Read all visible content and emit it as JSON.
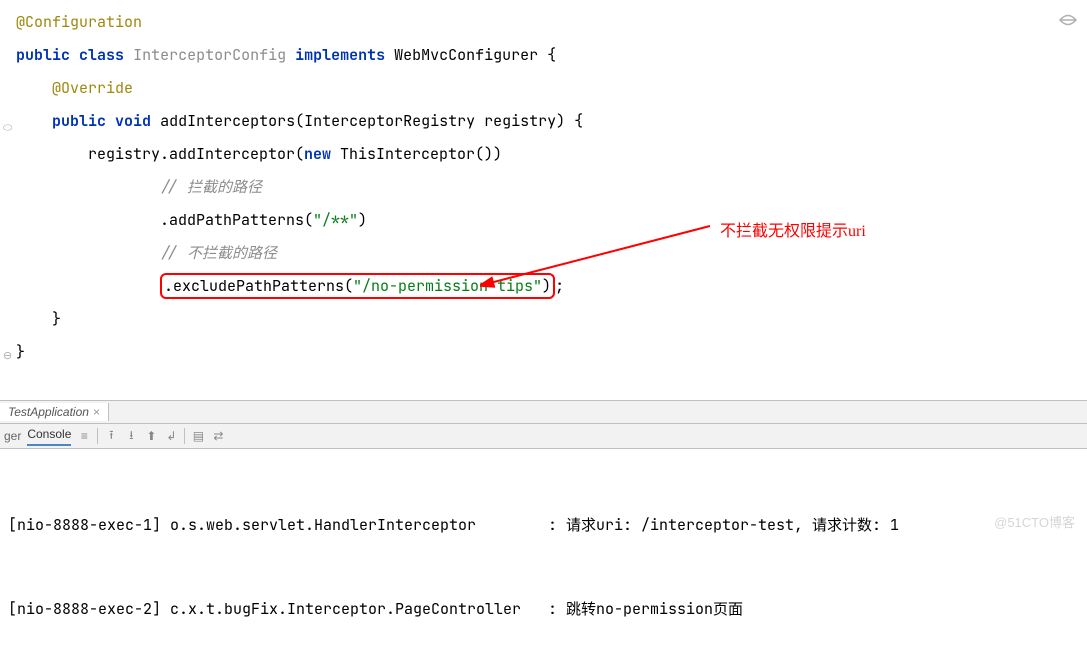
{
  "code": {
    "l1": "@Configuration",
    "l2a": "public",
    "l2b": "class",
    "l2c": "InterceptorConfig",
    "l2d": "implements",
    "l2e": "WebMvcConfigurer {",
    "l3": "@Override",
    "l4a": "public",
    "l4b": "void",
    "l4c": "addInterceptors(InterceptorRegistry registry) {",
    "l5a": "registry.addInterceptor(",
    "l5b": "new",
    "l5c": " ThisInterceptor())",
    "l6": "// 拦截的路径",
    "l7a": ".addPathPatterns(",
    "l7b": "\"/**\"",
    "l7c": ")",
    "l8": "// 不拦截的路径",
    "l9a": ".excludePathPatterns(",
    "l9b": "\"/no-permission-tips\"",
    "l9c": ")",
    "l9d": ";",
    "l10": "}",
    "l11": "}"
  },
  "annotation": "不拦截无权限提示uri",
  "tab_name": "TestApplication",
  "toolbar": {
    "ger": "ger",
    "console": "Console"
  },
  "console": {
    "line1a": "[nio-8888-exec-1] o.s.web.servlet.HandlerInterceptor        : 请求uri: /interceptor-test, 请求计数: 1",
    "line2a": "[nio-8888-exec-2] c.x.t.bugFix.Interceptor.PageController   : 跳转no-permission页面"
  },
  "watermark": "@51CTO博客"
}
